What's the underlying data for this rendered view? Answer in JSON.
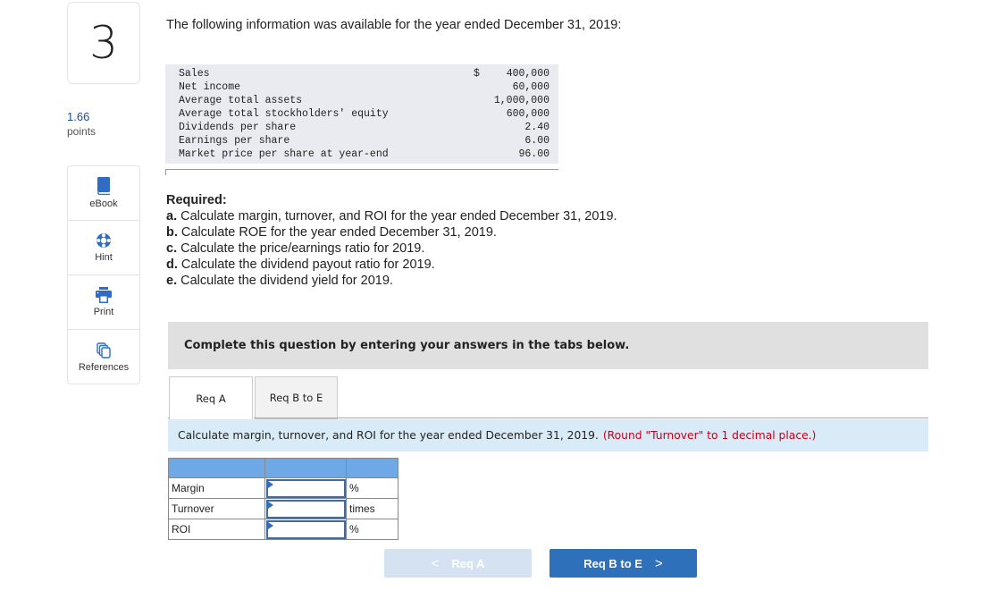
{
  "question": {
    "number": "3",
    "points_value": "1.66",
    "points_label": "points"
  },
  "tools": [
    {
      "label": "eBook",
      "icon": "book-icon"
    },
    {
      "label": "Hint",
      "icon": "lifebuoy-icon"
    },
    {
      "label": "Print",
      "icon": "printer-icon"
    },
    {
      "label": "References",
      "icon": "copies-icon"
    }
  ],
  "intro": "The following information was available for the year ended December 31, 2019:",
  "given_data": {
    "rows": [
      {
        "label": "Sales",
        "currency": "$",
        "value": "400,000"
      },
      {
        "label": "Net income",
        "currency": "",
        "value": "60,000"
      },
      {
        "label": "Average total assets",
        "currency": "",
        "value": "1,000,000"
      },
      {
        "label": "Average total stockholders' equity",
        "currency": "",
        "value": "600,000"
      },
      {
        "label": "Dividends per share",
        "currency": "",
        "value": "2.40"
      },
      {
        "label": "Earnings per share",
        "currency": "",
        "value": "6.00"
      },
      {
        "label": "Market price per share at year-end",
        "currency": "",
        "value": "96.00"
      }
    ]
  },
  "required": {
    "title": "Required:",
    "items": [
      {
        "letter": "a.",
        "text": " Calculate margin, turnover, and ROI for the year ended December 31, 2019."
      },
      {
        "letter": "b.",
        "text": " Calculate ROE for the year ended December 31, 2019."
      },
      {
        "letter": "c.",
        "text": " Calculate the price/earnings ratio for 2019."
      },
      {
        "letter": "d.",
        "text": " Calculate the dividend payout ratio for 2019."
      },
      {
        "letter": "e.",
        "text": " Calculate the dividend yield for 2019."
      }
    ]
  },
  "instruction": "Complete this question by entering your answers in the tabs below.",
  "tabs": [
    {
      "label": "Req A",
      "active": true
    },
    {
      "label": "Req B to E",
      "active": false
    }
  ],
  "prompt": {
    "text": "Calculate margin, turnover, and ROI for the year ended December 31, 2019.",
    "hint": "(Round \"Turnover\" to 1 decimal place.)"
  },
  "answer_table": {
    "rows": [
      {
        "label": "Margin",
        "value": "",
        "unit": "%"
      },
      {
        "label": "Turnover",
        "value": "",
        "unit": "times"
      },
      {
        "label": "ROI",
        "value": "",
        "unit": "%"
      }
    ]
  },
  "nav": {
    "prev_label": "Req A",
    "prev_icon": "chevron-left-icon",
    "next_label": "Req B to E",
    "next_icon": "chevron-right-icon"
  },
  "colors": {
    "accent": "#2f70bb",
    "hint_red": "#c4001a",
    "table_header_blue": "#6fa8e6",
    "prompt_bg": "#d9ebf7"
  }
}
